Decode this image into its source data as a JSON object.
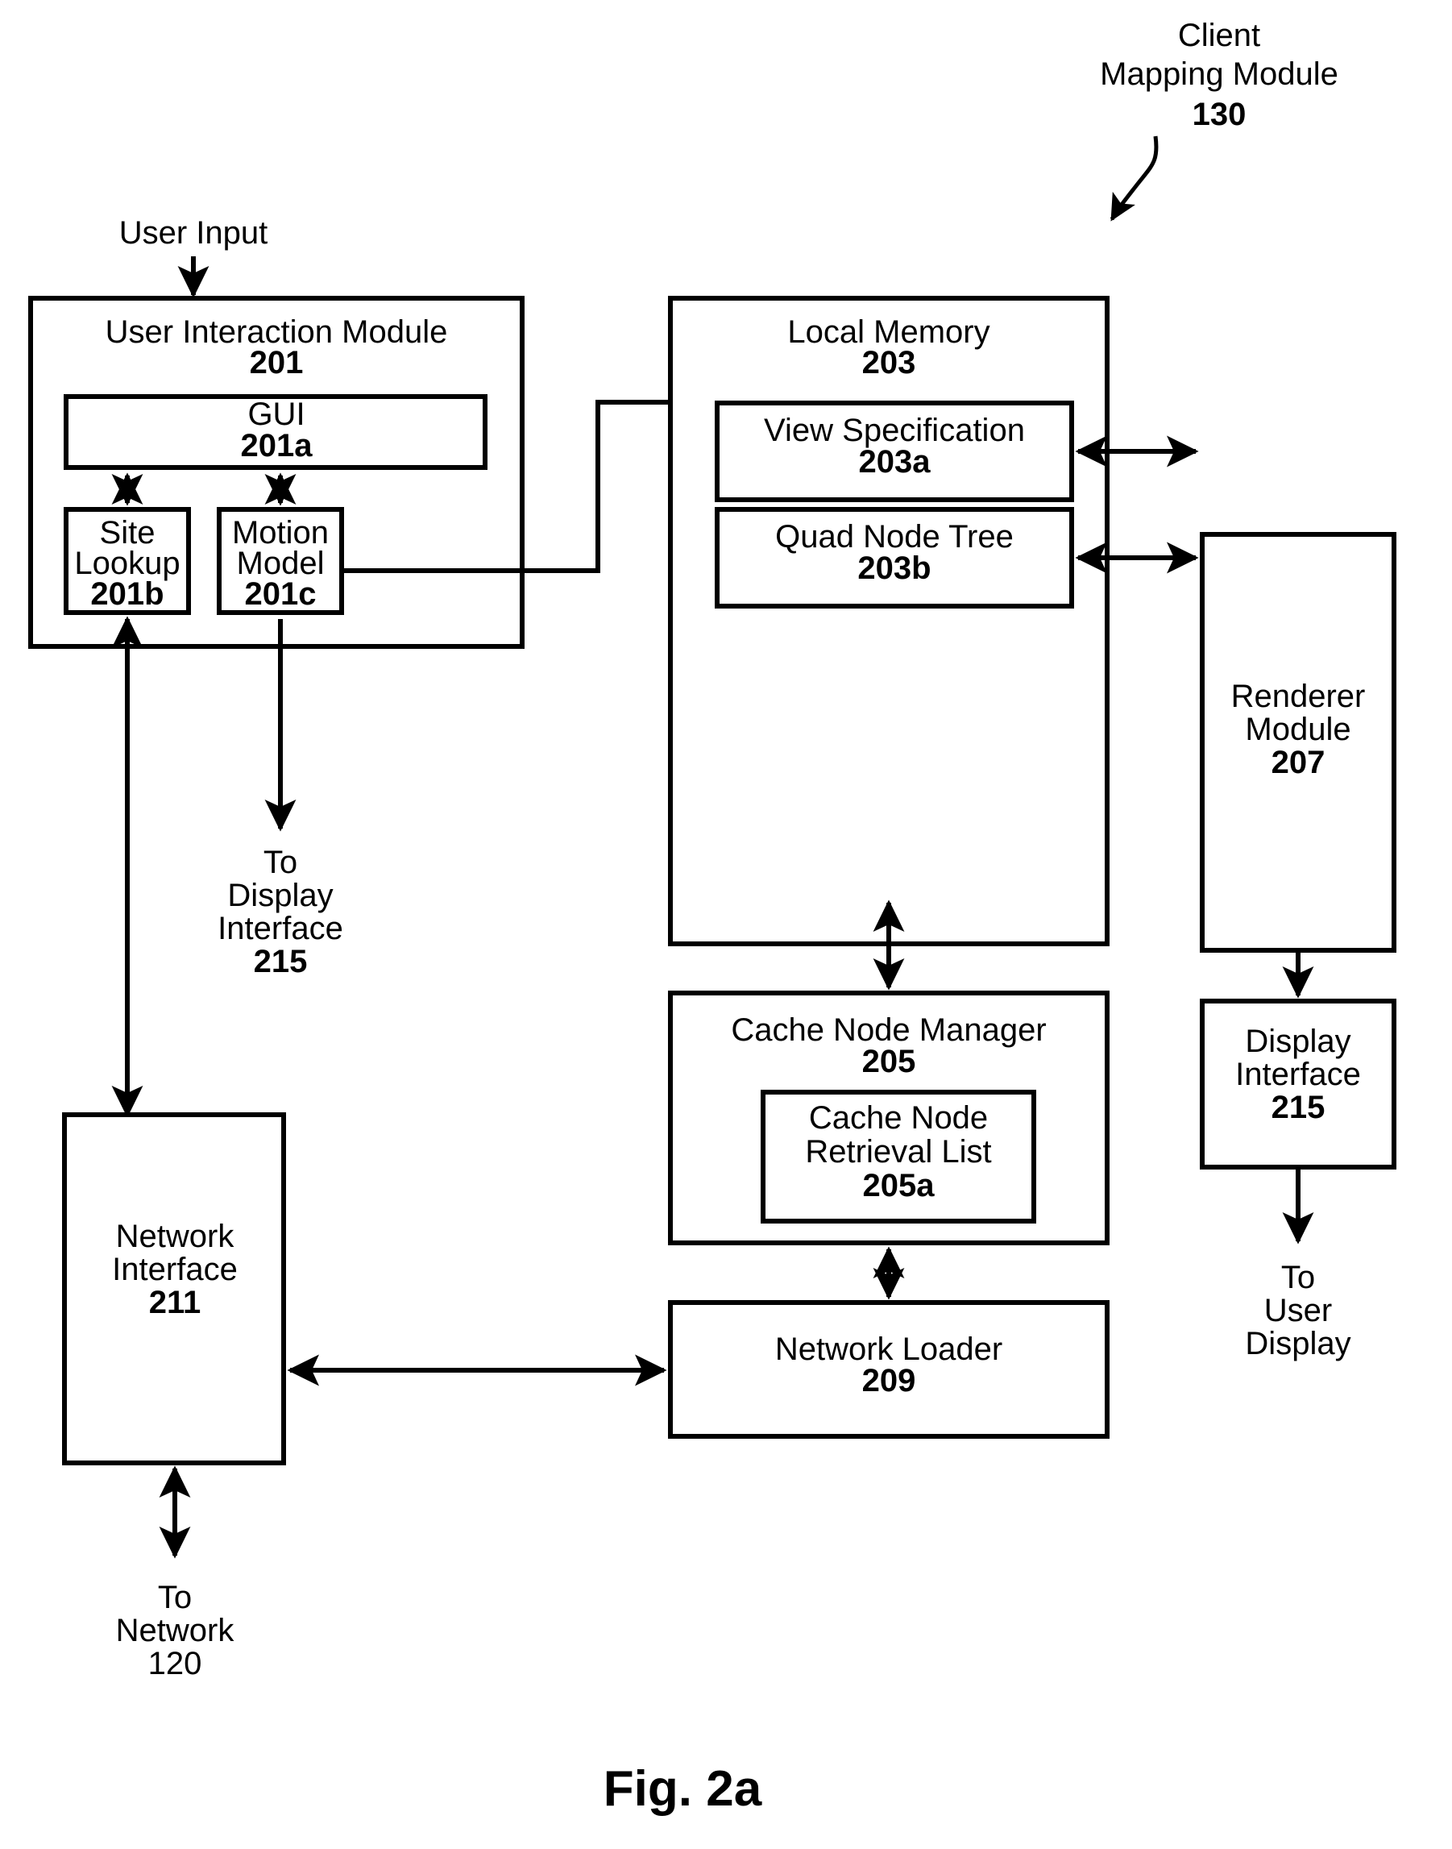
{
  "figure": {
    "caption": "Fig. 2a",
    "callout": {
      "title_line1": "Client",
      "title_line2": "Mapping Module",
      "ref": "130"
    }
  },
  "labels": {
    "user_input": "User Input",
    "to_display_interface_line1": "To",
    "to_display_interface_line2": "Display",
    "to_display_interface_line3": "Interface",
    "to_display_interface_ref": "215",
    "to_network_line1": "To",
    "to_network_line2": "Network",
    "to_network_ref": "120",
    "to_user_display_line1": "To",
    "to_user_display_line2": "User",
    "to_user_display_line3": "Display"
  },
  "blocks": {
    "user_interaction_module": {
      "name": "User Interaction Module",
      "ref": "201"
    },
    "gui": {
      "name": "GUI",
      "ref": "201a"
    },
    "site_lookup": {
      "name_line1": "Site",
      "name_line2": "Lookup",
      "ref": "201b"
    },
    "motion_model": {
      "name_line1": "Motion",
      "name_line2": "Model",
      "ref": "201c"
    },
    "local_memory": {
      "name": "Local Memory",
      "ref": "203"
    },
    "view_specification": {
      "name": "View Specification",
      "ref": "203a"
    },
    "quad_node_tree": {
      "name": "Quad Node Tree",
      "ref": "203b"
    },
    "cache_node_manager": {
      "name": "Cache Node Manager",
      "ref": "205"
    },
    "cache_node_retrieval_list": {
      "name_line1": "Cache Node",
      "name_line2": "Retrieval List",
      "ref": "205a"
    },
    "network_loader": {
      "name": "Network Loader",
      "ref": "209"
    },
    "network_interface": {
      "name_line1": "Network",
      "name_line2": "Interface",
      "ref": "211"
    },
    "renderer_module": {
      "name_line1": "Renderer",
      "name_line2": "Module",
      "ref": "207"
    },
    "display_interface": {
      "name_line1": "Display",
      "name_line2": "Interface",
      "ref": "215"
    }
  },
  "colors": {
    "stroke": "#000000",
    "fill": "#ffffff"
  }
}
